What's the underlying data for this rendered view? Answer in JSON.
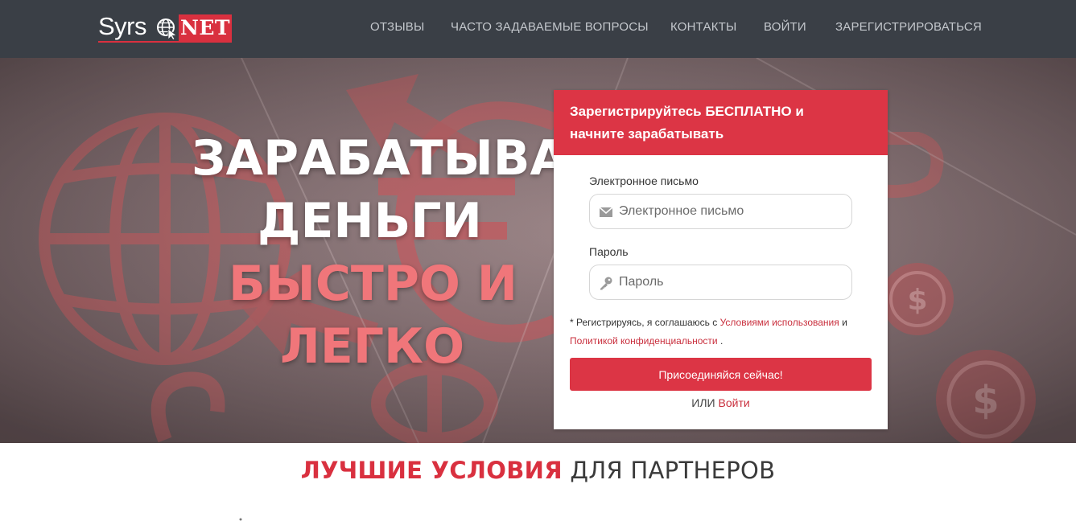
{
  "brand": {
    "logo_text": "Syrs",
    "logo_badge": "NET",
    "accent_color": "#dc3545",
    "navbar_color": "#3a3f46"
  },
  "nav": {
    "items": [
      {
        "label": "ОТЗЫВЫ"
      },
      {
        "label": "ЧАСТО ЗАДАВАЕМЫЕ ВОПРОСЫ"
      },
      {
        "label": "КОНТАКТЫ"
      },
      {
        "label": "ВОЙТИ"
      },
      {
        "label": "ЗАРЕГИСТРИРОВАТЬСЯ"
      }
    ]
  },
  "hero": {
    "line1": "ЗАРАБАТЫВАЙ",
    "line2": "ДЕНЬГИ",
    "line3": "БЫСТРО И",
    "line4": "ЛЕГКО"
  },
  "signup": {
    "heading_line1": "Зарегистрируйтесь БЕСПЛАТНО и",
    "heading_line2": "начните зарабатывать",
    "email_label": "Электронное письмо",
    "email_placeholder": "Электронное письмо",
    "email_icon": "envelope-icon",
    "password_label": "Пароль",
    "password_placeholder": "Пароль",
    "password_icon": "key-icon",
    "terms_prefix": "* Регистрируясь, я соглашаюсь с",
    "terms_link": "Условиями использования",
    "terms_and": "и",
    "privacy_link": "Политикой конфиденциальности",
    "terms_suffix": ".",
    "submit_label": "Присоединяйся сейчас!",
    "or_text": "ИЛИ",
    "login_link": "Войти"
  },
  "section": {
    "title_accent": "ЛУЧШИЕ УСЛОВИЯ",
    "title_rest": "ДЛЯ ПАРТНЕРОВ"
  }
}
